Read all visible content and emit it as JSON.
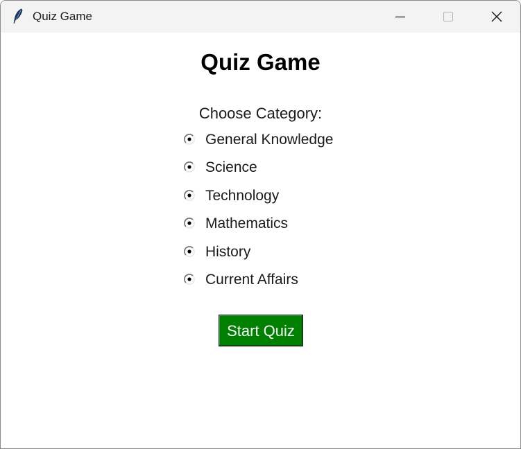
{
  "window": {
    "title": "Quiz Game",
    "icon": "feather-icon"
  },
  "main": {
    "heading": "Quiz Game",
    "choose_label": "Choose Category:",
    "categories": [
      {
        "label": "General Knowledge"
      },
      {
        "label": "Science"
      },
      {
        "label": "Technology"
      },
      {
        "label": "Mathematics"
      },
      {
        "label": "History"
      },
      {
        "label": "Current Affairs"
      }
    ],
    "start_button_label": "Start Quiz"
  },
  "colors": {
    "start_button_bg": "#008000",
    "titlebar_bg": "#f3f3f3"
  }
}
